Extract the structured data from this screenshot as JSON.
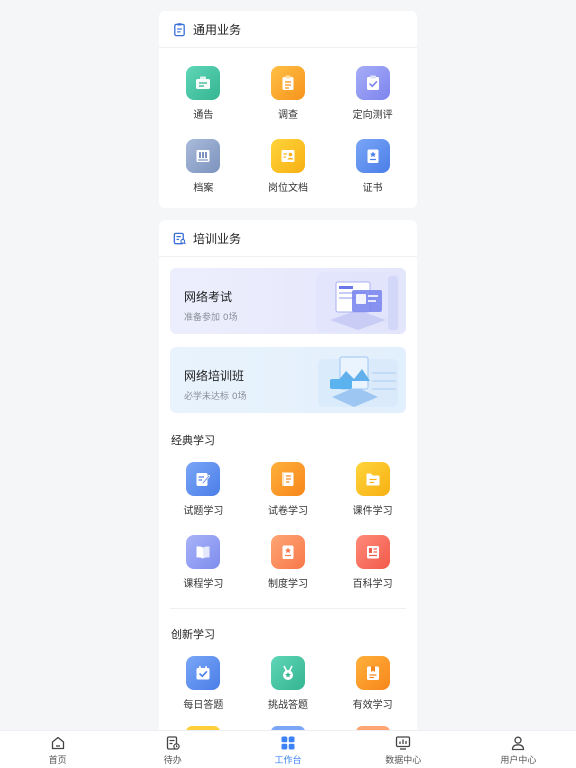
{
  "general": {
    "title": "通用业务",
    "items": [
      {
        "label": "通告",
        "icon": "notice-icon",
        "color": "#3dbfa0"
      },
      {
        "label": "调查",
        "icon": "survey-icon",
        "color": "#f7a21b"
      },
      {
        "label": "定向测评",
        "icon": "evaluation-icon",
        "color": "#8b8ff2"
      },
      {
        "label": "档案",
        "icon": "archive-icon",
        "color": "#8fa5c9"
      },
      {
        "label": "岗位文档",
        "icon": "job-document-icon",
        "color": "#f9b81c"
      },
      {
        "label": "证书",
        "icon": "certificate-icon",
        "color": "#5b8def"
      }
    ]
  },
  "training": {
    "title": "培训业务",
    "banners": [
      {
        "title": "网络考试",
        "subtitle": "准备参加 0场",
        "bg": "#eef0fd"
      },
      {
        "title": "网络培训班",
        "subtitle": "必学未达标 0场",
        "bg": "#eaf4fd"
      }
    ],
    "classic": {
      "title": "经典学习",
      "items": [
        {
          "label": "试题学习",
          "icon": "question-study-icon",
          "color": "#5b8def"
        },
        {
          "label": "试卷学习",
          "icon": "paper-study-icon",
          "color": "#f7931b"
        },
        {
          "label": "课件学习",
          "icon": "courseware-icon",
          "color": "#f9b81c"
        },
        {
          "label": "课程学习",
          "icon": "course-book-icon",
          "color": "#8b97f2"
        },
        {
          "label": "制度学习",
          "icon": "regulation-icon",
          "color": "#f7885a"
        },
        {
          "label": "百科学习",
          "icon": "encyclopedia-icon",
          "color": "#f26b5b"
        }
      ]
    },
    "innovation": {
      "title": "创新学习",
      "items": [
        {
          "label": "每日答题",
          "icon": "daily-quiz-icon",
          "color": "#5b8def"
        },
        {
          "label": "挑战答题",
          "icon": "challenge-medal-icon",
          "color": "#3dbfa0"
        },
        {
          "label": "有效学习",
          "icon": "effective-study-icon",
          "color": "#f7931b"
        }
      ]
    }
  },
  "tabbar": {
    "items": [
      {
        "label": "首页",
        "icon": "home-icon"
      },
      {
        "label": "待办",
        "icon": "todo-icon"
      },
      {
        "label": "工作台",
        "icon": "workbench-icon",
        "active": true
      },
      {
        "label": "数据中心",
        "icon": "data-center-icon"
      },
      {
        "label": "用户中心",
        "icon": "user-center-icon"
      }
    ],
    "active_color": "#3b82f6"
  }
}
